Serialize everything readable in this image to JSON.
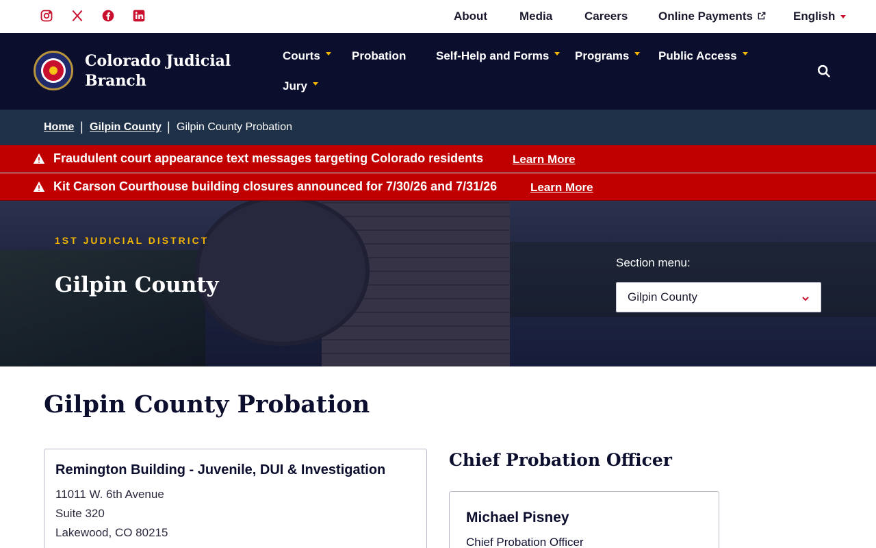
{
  "social": [
    {
      "icon": "instagram-icon"
    },
    {
      "icon": "x-icon"
    },
    {
      "icon": "facebook-icon"
    },
    {
      "icon": "linkedin-icon"
    }
  ],
  "utility_nav": {
    "about": "About",
    "media": "Media",
    "careers": "Careers",
    "payments": "Online Payments",
    "language": "English"
  },
  "brand": {
    "name": "Colorado Judicial Branch"
  },
  "main_nav": {
    "courts": "Courts",
    "probation": "Probation",
    "self_help": "Self-Help and Forms",
    "programs": "Programs",
    "public_access": "Public Access",
    "jury": "Jury"
  },
  "breadcrumb": {
    "home": "Home",
    "county": "Gilpin County",
    "current": "Gilpin County Probation"
  },
  "alerts": [
    {
      "text": "Fraudulent court appearance text messages targeting Colorado residents",
      "link": "Learn More"
    },
    {
      "text": "Kit Carson Courthouse building closures announced for 7/30/26 and 7/31/26",
      "link": "Learn More"
    }
  ],
  "hero": {
    "district": "1ST JUDICIAL DISTRICT",
    "title": "Gilpin County",
    "section_menu_label": "Section menu:",
    "section_menu_value": "Gilpin County"
  },
  "main": {
    "page_title": "Gilpin County Probation",
    "location": {
      "title": "Remington Building - Juvenile, DUI & Investigation",
      "address_line1": "11011 W. 6th Avenue",
      "address_line2": "Suite 320",
      "address_line3": "Lakewood, CO 80215"
    },
    "officer_heading": "Chief Probation Officer",
    "officer": {
      "name": "Michael Pisney",
      "role": "Chief Probation Officer"
    }
  },
  "colors": {
    "navy": "#0c0e2e",
    "alert_red": "#c00000",
    "accent_gold": "#f5b700",
    "accent_red": "#c8102e"
  }
}
